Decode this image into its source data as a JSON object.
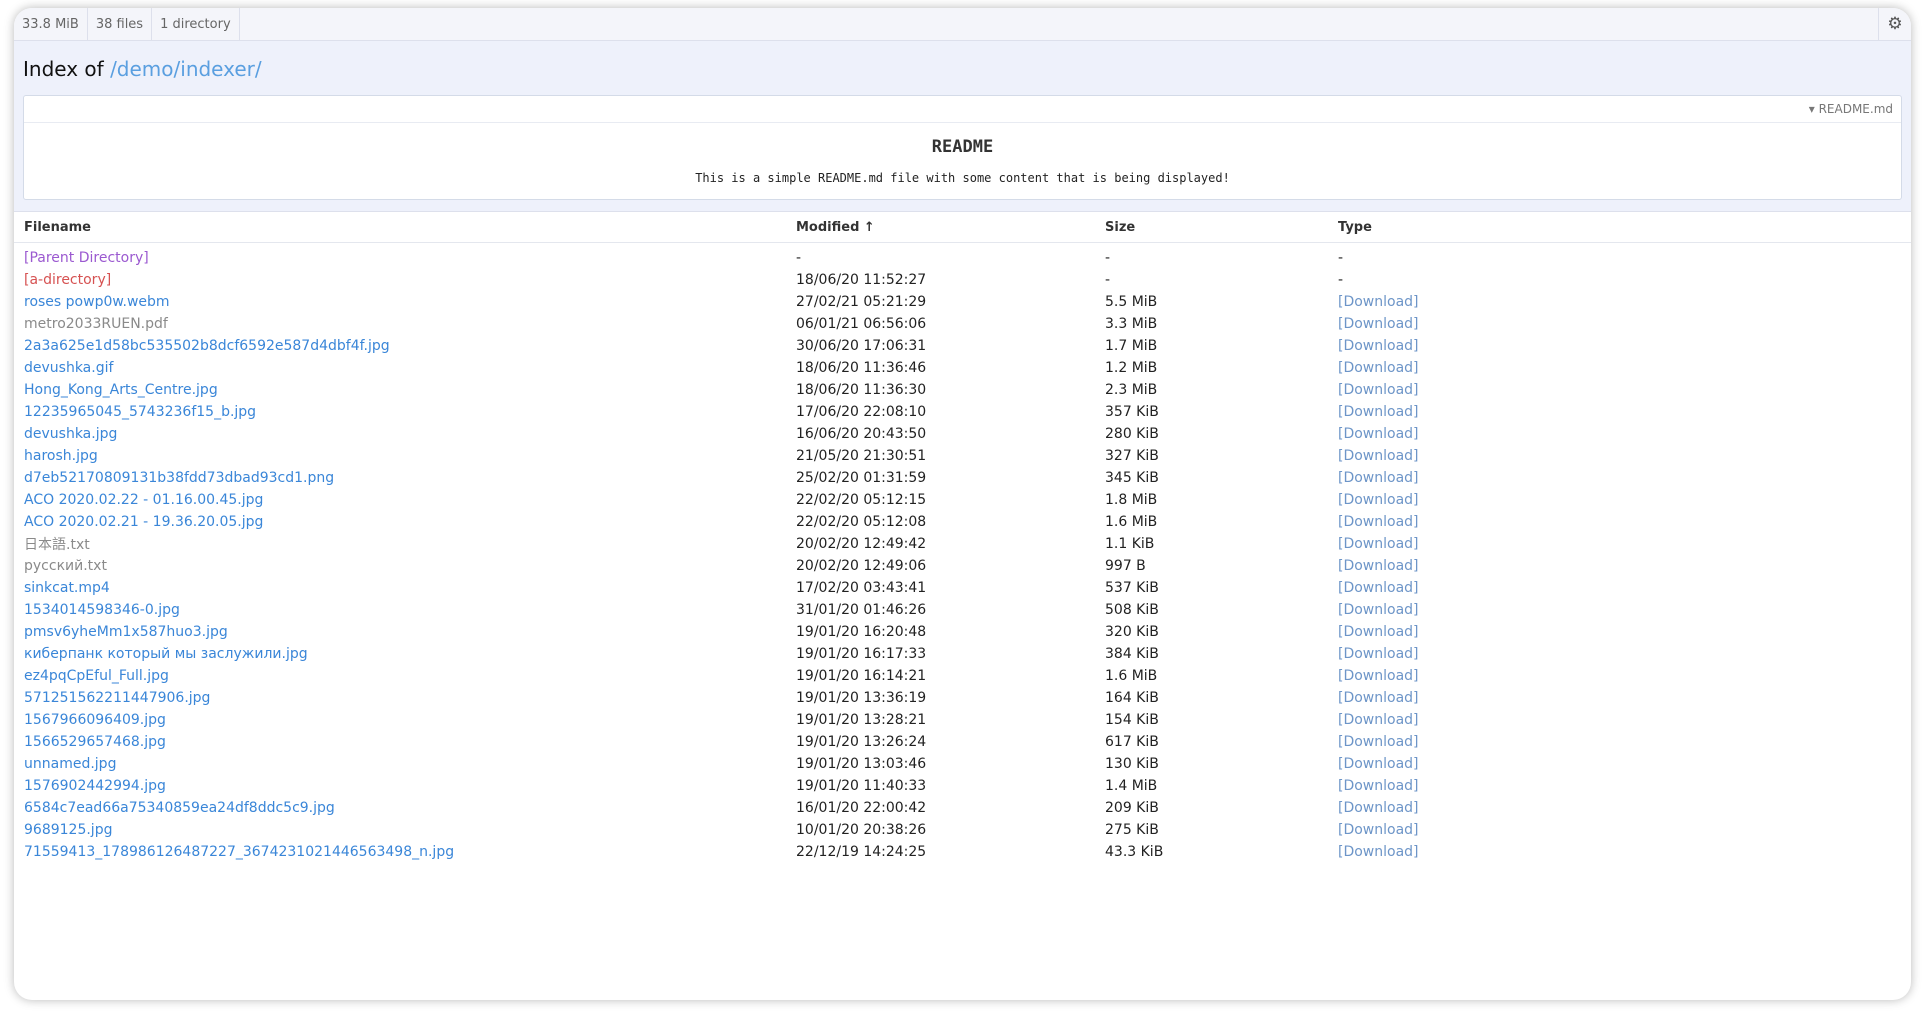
{
  "topbar": {
    "size": "33.8 MiB",
    "files": "38 files",
    "dirs": "1 directory"
  },
  "title": {
    "prefix": "Index of",
    "path": "/demo/indexer/"
  },
  "readme": {
    "filename": "▾ README.md",
    "heading": "README",
    "body": "This is a simple README.md file with some content that is being displayed!"
  },
  "columns": {
    "filename": "Filename",
    "modified": "Modified ↑",
    "size": "Size",
    "type": "Type"
  },
  "rows": [
    {
      "name": "[Parent Directory]",
      "modified": "-",
      "size": "-",
      "type": "-",
      "kind": "parent"
    },
    {
      "name": "[a-directory]",
      "modified": "18/06/20 11:52:27",
      "size": "-",
      "type": "-",
      "kind": "dir"
    },
    {
      "name": "roses powp0w.webm",
      "modified": "27/02/21 05:21:29",
      "size": "5.5 MiB",
      "type": "[Download]",
      "kind": "file"
    },
    {
      "name": "metro2033RUEN.pdf",
      "modified": "06/01/21 06:56:06",
      "size": "3.3 MiB",
      "type": "[Download]",
      "kind": "grey"
    },
    {
      "name": "2a3a625e1d58bc535502b8dcf6592e587d4dbf4f.jpg",
      "modified": "30/06/20 17:06:31",
      "size": "1.7 MiB",
      "type": "[Download]",
      "kind": "file"
    },
    {
      "name": "devushka.gif",
      "modified": "18/06/20 11:36:46",
      "size": "1.2 MiB",
      "type": "[Download]",
      "kind": "file"
    },
    {
      "name": "Hong_Kong_Arts_Centre.jpg",
      "modified": "18/06/20 11:36:30",
      "size": "2.3 MiB",
      "type": "[Download]",
      "kind": "file"
    },
    {
      "name": "12235965045_5743236f15_b.jpg",
      "modified": "17/06/20 22:08:10",
      "size": "357 KiB",
      "type": "[Download]",
      "kind": "file"
    },
    {
      "name": "devushka.jpg",
      "modified": "16/06/20 20:43:50",
      "size": "280 KiB",
      "type": "[Download]",
      "kind": "file"
    },
    {
      "name": "harosh.jpg",
      "modified": "21/05/20 21:30:51",
      "size": "327 KiB",
      "type": "[Download]",
      "kind": "file"
    },
    {
      "name": "d7eb52170809131b38fdd73dbad93cd1.png",
      "modified": "25/02/20 01:31:59",
      "size": "345 KiB",
      "type": "[Download]",
      "kind": "file"
    },
    {
      "name": "ACO 2020.02.22 - 01.16.00.45.jpg",
      "modified": "22/02/20 05:12:15",
      "size": "1.8 MiB",
      "type": "[Download]",
      "kind": "file"
    },
    {
      "name": "ACO 2020.02.21 - 19.36.20.05.jpg",
      "modified": "22/02/20 05:12:08",
      "size": "1.6 MiB",
      "type": "[Download]",
      "kind": "file"
    },
    {
      "name": "日本語.txt",
      "modified": "20/02/20 12:49:42",
      "size": "1.1 KiB",
      "type": "[Download]",
      "kind": "grey"
    },
    {
      "name": "русский.txt",
      "modified": "20/02/20 12:49:06",
      "size": "997 B",
      "type": "[Download]",
      "kind": "grey"
    },
    {
      "name": "sinkcat.mp4",
      "modified": "17/02/20 03:43:41",
      "size": "537 KiB",
      "type": "[Download]",
      "kind": "file"
    },
    {
      "name": "1534014598346-0.jpg",
      "modified": "31/01/20 01:46:26",
      "size": "508 KiB",
      "type": "[Download]",
      "kind": "file"
    },
    {
      "name": "pmsv6yheMm1x587huo3.jpg",
      "modified": "19/01/20 16:20:48",
      "size": "320 KiB",
      "type": "[Download]",
      "kind": "file"
    },
    {
      "name": "киберпанк который мы заслужили.jpg",
      "modified": "19/01/20 16:17:33",
      "size": "384 KiB",
      "type": "[Download]",
      "kind": "file"
    },
    {
      "name": "ez4pqCpEful_Full.jpg",
      "modified": "19/01/20 16:14:21",
      "size": "1.6 MiB",
      "type": "[Download]",
      "kind": "file"
    },
    {
      "name": "571251562211447906.jpg",
      "modified": "19/01/20 13:36:19",
      "size": "164 KiB",
      "type": "[Download]",
      "kind": "file"
    },
    {
      "name": "1567966096409.jpg",
      "modified": "19/01/20 13:28:21",
      "size": "154 KiB",
      "type": "[Download]",
      "kind": "file"
    },
    {
      "name": "1566529657468.jpg",
      "modified": "19/01/20 13:26:24",
      "size": "617 KiB",
      "type": "[Download]",
      "kind": "file"
    },
    {
      "name": "unnamed.jpg",
      "modified": "19/01/20 13:03:46",
      "size": "130 KiB",
      "type": "[Download]",
      "kind": "file"
    },
    {
      "name": "1576902442994.jpg",
      "modified": "19/01/20 11:40:33",
      "size": "1.4 MiB",
      "type": "[Download]",
      "kind": "file"
    },
    {
      "name": "6584c7ead66a75340859ea24df8ddc5c9.jpg",
      "modified": "16/01/20 22:00:42",
      "size": "209 KiB",
      "type": "[Download]",
      "kind": "file"
    },
    {
      "name": "9689125.jpg",
      "modified": "10/01/20 20:38:26",
      "size": "275 KiB",
      "type": "[Download]",
      "kind": "file"
    },
    {
      "name": "71559413_178986126487227_3674231021446563498_n.jpg",
      "modified": "22/12/19 14:24:25",
      "size": "43.3 KiB",
      "type": "[Download]",
      "kind": "file"
    }
  ]
}
